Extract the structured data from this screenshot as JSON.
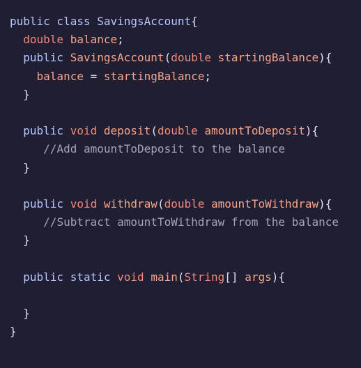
{
  "editor": {
    "lines": [
      [
        {
          "t": "public class ",
          "c": "kw"
        },
        {
          "t": "SavingsAccount",
          "c": "kw"
        },
        {
          "t": "{",
          "c": "pu"
        }
      ],
      [
        {
          "t": "  ",
          "c": "pu"
        },
        {
          "t": "double",
          "c": "ty"
        },
        {
          "t": " ",
          "c": "pu"
        },
        {
          "t": "balance",
          "c": "id"
        },
        {
          "t": ";",
          "c": "pu"
        }
      ],
      [
        {
          "t": "  ",
          "c": "pu"
        },
        {
          "t": "public",
          "c": "kw"
        },
        {
          "t": " ",
          "c": "pu"
        },
        {
          "t": "SavingsAccount",
          "c": "id"
        },
        {
          "t": "(",
          "c": "pu"
        },
        {
          "t": "double",
          "c": "ty"
        },
        {
          "t": " ",
          "c": "pu"
        },
        {
          "t": "startingBalance",
          "c": "id"
        },
        {
          "t": "){",
          "c": "pu"
        }
      ],
      [
        {
          "t": "    ",
          "c": "pu"
        },
        {
          "t": "balance",
          "c": "id"
        },
        {
          "t": " = ",
          "c": "pu"
        },
        {
          "t": "startingBalance",
          "c": "id"
        },
        {
          "t": ";",
          "c": "pu"
        }
      ],
      [
        {
          "t": "  }",
          "c": "pu"
        }
      ],
      [],
      [
        {
          "t": "  ",
          "c": "pu"
        },
        {
          "t": "public",
          "c": "kw"
        },
        {
          "t": " ",
          "c": "pu"
        },
        {
          "t": "void",
          "c": "ty"
        },
        {
          "t": " ",
          "c": "pu"
        },
        {
          "t": "deposit",
          "c": "id"
        },
        {
          "t": "(",
          "c": "pu"
        },
        {
          "t": "double",
          "c": "ty"
        },
        {
          "t": " ",
          "c": "pu"
        },
        {
          "t": "amountToDeposit",
          "c": "id"
        },
        {
          "t": "){",
          "c": "pu"
        }
      ],
      [
        {
          "t": "     ",
          "c": "pu"
        },
        {
          "t": "//Add amountToDeposit to the balance",
          "c": "cm"
        }
      ],
      [
        {
          "t": "  }",
          "c": "pu"
        }
      ],
      [],
      [
        {
          "t": "  ",
          "c": "pu"
        },
        {
          "t": "public",
          "c": "kw"
        },
        {
          "t": " ",
          "c": "pu"
        },
        {
          "t": "void",
          "c": "ty"
        },
        {
          "t": " ",
          "c": "pu"
        },
        {
          "t": "withdraw",
          "c": "id"
        },
        {
          "t": "(",
          "c": "pu"
        },
        {
          "t": "double",
          "c": "ty"
        },
        {
          "t": " ",
          "c": "pu"
        },
        {
          "t": "amountToWithdraw",
          "c": "id"
        },
        {
          "t": "){",
          "c": "pu"
        }
      ],
      [
        {
          "t": "     ",
          "c": "pu"
        },
        {
          "t": "//Subtract amountToWithdraw from the balance",
          "c": "cm"
        }
      ],
      [
        {
          "t": "  }",
          "c": "pu"
        }
      ],
      [],
      [
        {
          "t": "  ",
          "c": "pu"
        },
        {
          "t": "public",
          "c": "kw"
        },
        {
          "t": " ",
          "c": "pu"
        },
        {
          "t": "static",
          "c": "kw"
        },
        {
          "t": " ",
          "c": "pu"
        },
        {
          "t": "void",
          "c": "ty"
        },
        {
          "t": " ",
          "c": "pu"
        },
        {
          "t": "main",
          "c": "id"
        },
        {
          "t": "(",
          "c": "pu"
        },
        {
          "t": "String",
          "c": "ty"
        },
        {
          "t": "[] ",
          "c": "pu"
        },
        {
          "t": "args",
          "c": "id"
        },
        {
          "t": "){",
          "c": "pu"
        }
      ],
      [],
      [
        {
          "t": "  }",
          "c": "pu"
        }
      ],
      [
        {
          "t": "}",
          "c": "pu"
        }
      ]
    ]
  }
}
